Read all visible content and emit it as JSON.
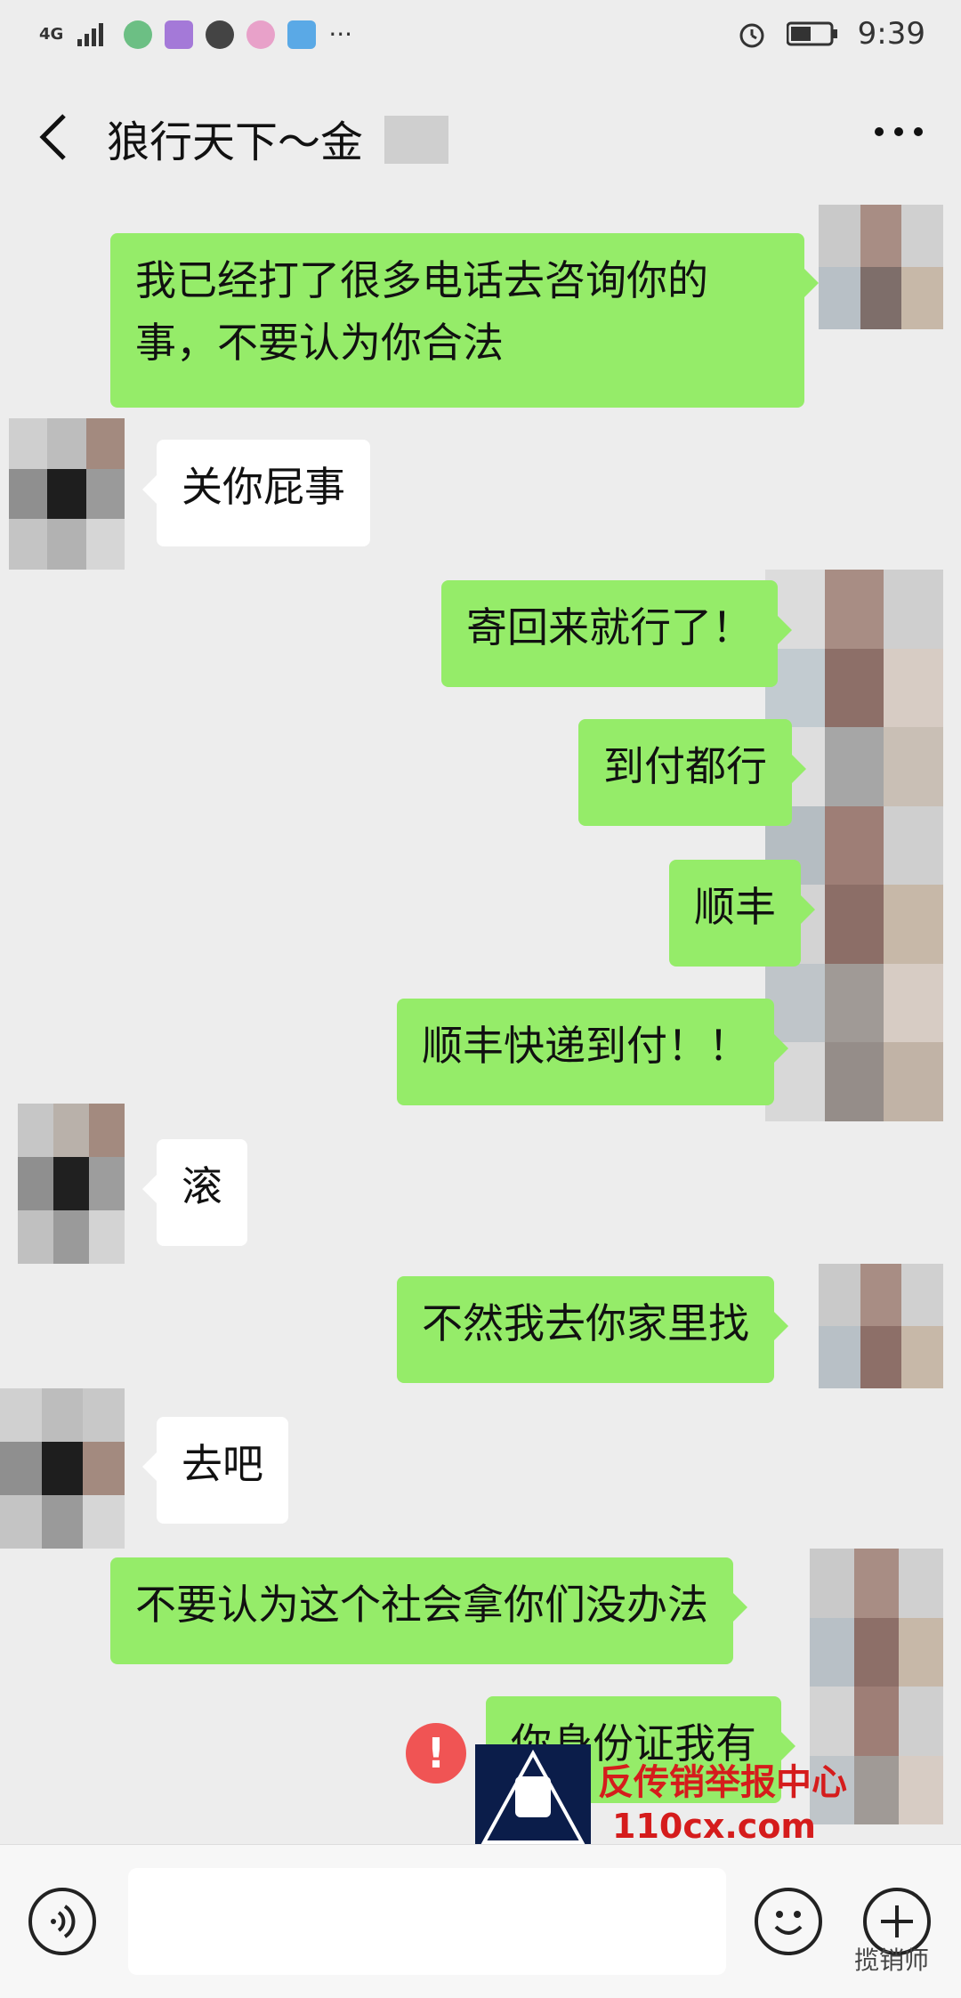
{
  "status_bar": {
    "network": "4G",
    "time": "9:39",
    "more_dots": "···"
  },
  "header": {
    "title": "狼行天下～金",
    "more": "···"
  },
  "messages": [
    {
      "from": "me",
      "text": "我已经打了很多电话去咨询你的\n事，不要认为你合法"
    },
    {
      "from": "other",
      "text": "关你屁事"
    },
    {
      "from": "me",
      "text": "寄回来就行了！"
    },
    {
      "from": "me",
      "text": "到付都行"
    },
    {
      "from": "me",
      "text": "顺丰"
    },
    {
      "from": "me",
      "text": "顺丰快递到付！！"
    },
    {
      "from": "other",
      "text": "滚"
    },
    {
      "from": "me",
      "text": "不然我去你家里找"
    },
    {
      "from": "other",
      "text": "去吧"
    },
    {
      "from": "me",
      "text": "不要认为这个社会拿你们没办法"
    },
    {
      "from": "me",
      "text": "你身份证我有"
    }
  ],
  "warning_icon": "!",
  "watermark": {
    "line1": "反传销举报中心",
    "line2": "110cx.com",
    "brand": "揽销师"
  },
  "toolbar": {
    "voice_icon": "voice-icon",
    "emoji_icon": "emoji-icon",
    "plus_icon": "plus-icon"
  }
}
